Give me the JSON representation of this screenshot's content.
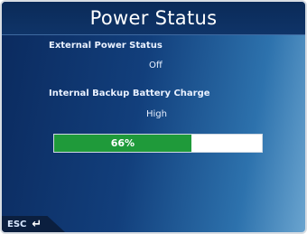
{
  "window": {
    "title": "Power Status"
  },
  "external_power": {
    "label": "External Power Status",
    "value": "Off"
  },
  "internal_battery": {
    "label": "Internal Backup Battery Charge",
    "value": "High"
  },
  "battery_bar": {
    "percent_text": "66%",
    "fill_fraction": 0.66,
    "fill_color": "#1f9a3a"
  },
  "footer": {
    "esc_label": "ESC",
    "back_icon": "return-arrow-icon"
  }
}
